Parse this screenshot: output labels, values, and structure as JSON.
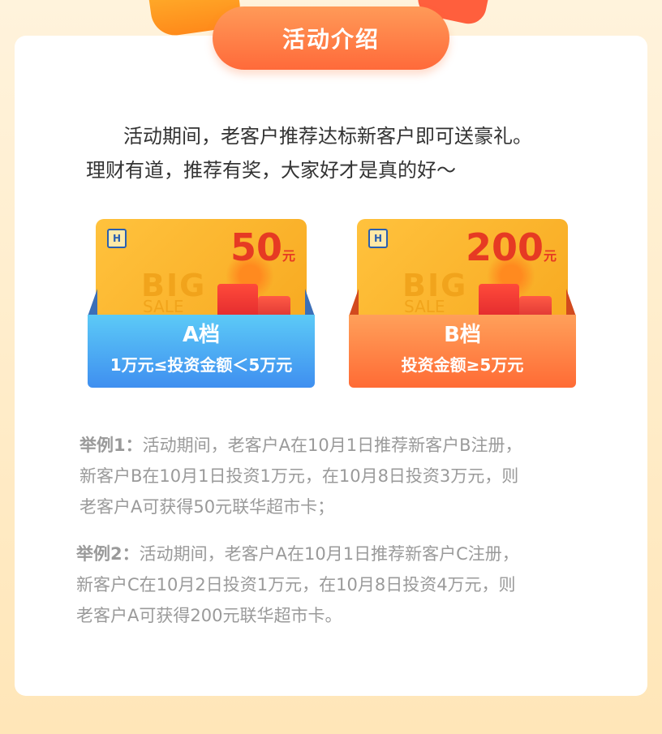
{
  "header": {
    "title": "活动介绍"
  },
  "intro": {
    "line1": "活动期间，老客户推荐达标新客户即可送豪礼。",
    "line2": "理财有道，推荐有奖，大家好才是真的好～"
  },
  "tiers": [
    {
      "card_logo": "H",
      "card_big": "BIG",
      "card_sale": "SALE",
      "amount": "50",
      "unit": "元",
      "tier": "A档",
      "condition": "1万元≤投资金额＜5万元",
      "color": "#4aa8f5"
    },
    {
      "card_logo": "H",
      "card_big": "BIG",
      "card_sale": "SALE",
      "amount": "200",
      "unit": "元",
      "tier": "B档",
      "condition": "投资金额≥5万元",
      "color": "#ff7a3e"
    }
  ],
  "examples": [
    {
      "label": "举例1：",
      "lines": [
        "活动期间，老客户A在10月1日推荐新客户B注册，",
        "新客户B在10月1日投资1万元，在10月8日投资3万元，则",
        "老客户A可获得50元联华超市卡；"
      ]
    },
    {
      "label": "举例2：",
      "lines": [
        "活动期间，老客户A在10月1日推荐新客户C注册，",
        "新客户C在10月2日投资1万元，在10月8日投资4万元，则",
        "老客户A可获得200元联华超市卡。"
      ]
    }
  ],
  "colors": {
    "accent_orange": "#ff7a3e",
    "accent_blue": "#4aa8f5",
    "amount_red": "#e63a23"
  }
}
